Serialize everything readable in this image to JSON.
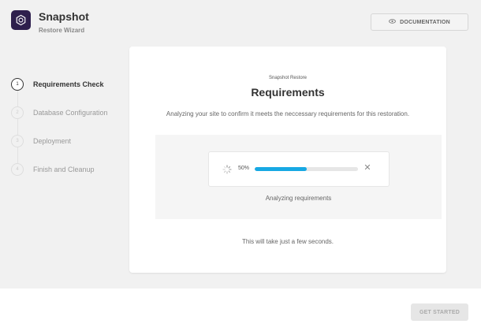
{
  "header": {
    "app_title": "Snapshot",
    "app_subtitle": "Restore Wizard",
    "documentation_label": "DOCUMENTATION",
    "logo_icon": "snapshot-logo-icon",
    "documentation_icon": "eye-icon"
  },
  "steps": [
    {
      "number": "1",
      "label": "Requirements Check",
      "active": true
    },
    {
      "number": "2",
      "label": "Database Configuration",
      "active": false
    },
    {
      "number": "3",
      "label": "Deployment",
      "active": false
    },
    {
      "number": "4",
      "label": "Finish and Cleanup",
      "active": false
    }
  ],
  "card": {
    "kicker": "Snapshot Restore",
    "title": "Requirements",
    "description": "Analyzing your site to confirm it meets the neccessary requirements for this restoration.",
    "progress": {
      "percent_label": "50%",
      "percent": 50,
      "status": "Analyzing requirements"
    },
    "footer": "This will take just a few seconds."
  },
  "footer": {
    "get_started_label": "GET STARTED"
  },
  "colors": {
    "accent": "#17a8e3",
    "logo_bg": "#2e1f4d"
  }
}
